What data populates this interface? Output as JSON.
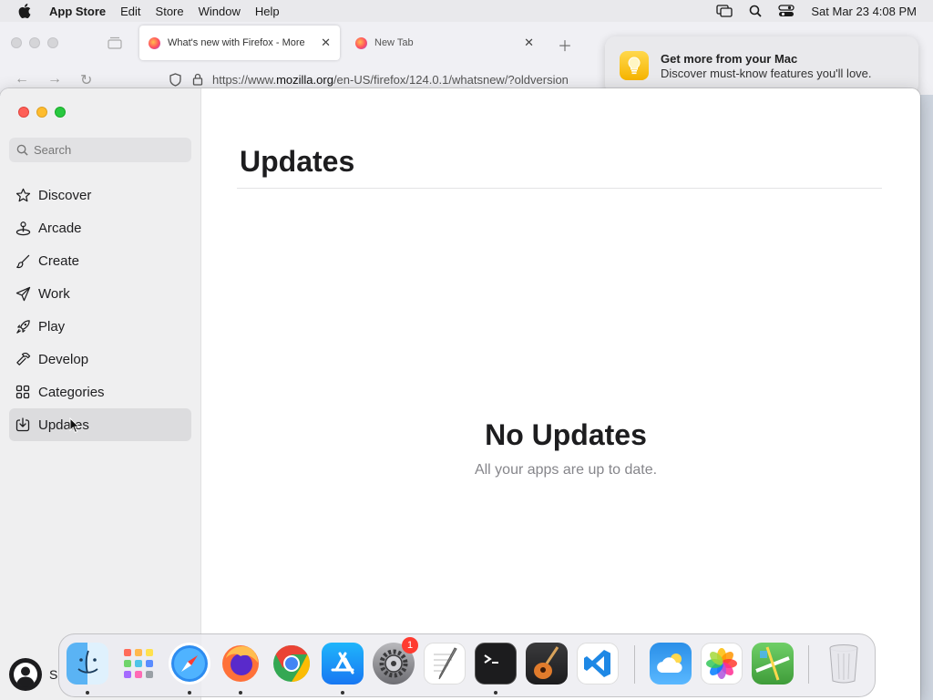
{
  "menubar": {
    "app_name": "App Store",
    "items": [
      "Edit",
      "Store",
      "Window",
      "Help"
    ],
    "datetime": "Sat Mar 23  4:08 PM"
  },
  "firefox": {
    "tabs": [
      {
        "title": "What's new with Firefox - More",
        "active": true
      },
      {
        "title": "New Tab",
        "active": false
      }
    ],
    "url": {
      "prefix": "https://www.",
      "host": "mozilla.org",
      "path": "/en-US/firefox/124.0.1/whatsnew/?oldversion"
    }
  },
  "notification": {
    "title": "Get more from your Mac",
    "body": "Discover must-know features you'll love."
  },
  "sidebar": {
    "search_placeholder": "Search",
    "items": [
      {
        "label": "Discover",
        "icon": "star-icon"
      },
      {
        "label": "Arcade",
        "icon": "joystick-icon"
      },
      {
        "label": "Create",
        "icon": "paintbrush-icon"
      },
      {
        "label": "Work",
        "icon": "paperplane-icon"
      },
      {
        "label": "Play",
        "icon": "rocket-icon"
      },
      {
        "label": "Develop",
        "icon": "hammer-icon"
      },
      {
        "label": "Categories",
        "icon": "grid-icon"
      },
      {
        "label": "Updates",
        "icon": "download-icon",
        "selected": true
      }
    ],
    "account_label": "S"
  },
  "main": {
    "title": "Updates",
    "empty_title": "No Updates",
    "empty_subtitle": "All your apps are up to date."
  },
  "dock": {
    "apps": [
      "Finder",
      "Launchpad",
      "Safari",
      "Firefox",
      "Chrome",
      "App Store",
      "System Settings",
      "TextEdit",
      "Terminal",
      "GarageBand",
      "VS Code",
      "Weather",
      "Photos",
      "Maps",
      "Trash"
    ],
    "settings_badge": "1"
  },
  "colors": {
    "selected_row": "#dcdcde",
    "sidebar_bg": "#efeff0",
    "badge": "#ff3b30"
  }
}
